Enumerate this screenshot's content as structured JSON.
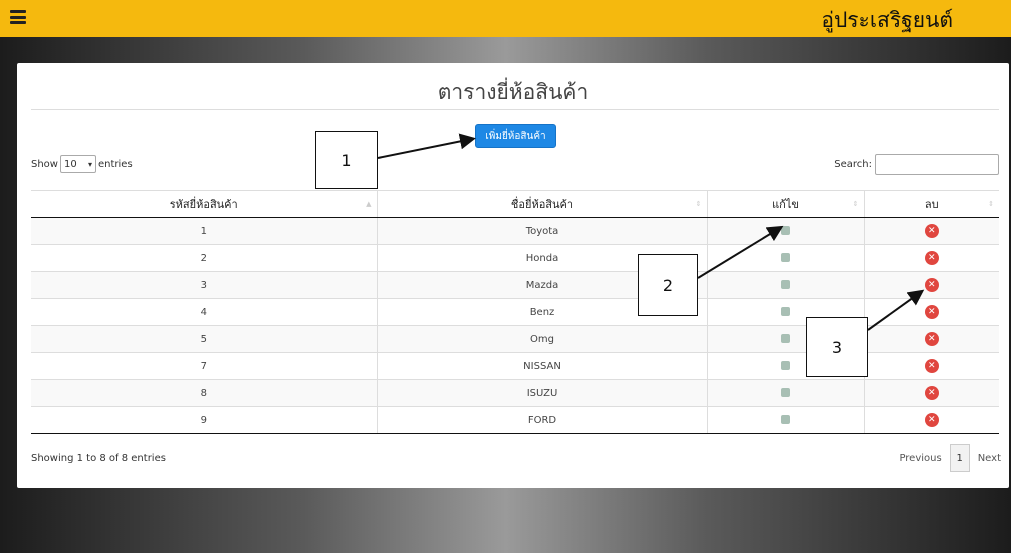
{
  "header": {
    "menu_icon": "hamburger-icon",
    "brand": "อู่ประเสริฐยนต์",
    "color": "#f5b90e"
  },
  "page": {
    "title": "ตารางยี่ห้อสินค้า",
    "add_button": "เพิ่มยี่ห้อสินค้า",
    "show_label": "Show",
    "entries_value": "10",
    "entries_label": "entries",
    "search_label": "Search:",
    "search_value": ""
  },
  "table": {
    "columns": [
      "รหัสยี่ห้อสินค้า",
      "ชื่อยี่ห้อสินค้า",
      "แก้ไข",
      "ลบ"
    ],
    "rows": [
      {
        "id": "1",
        "name": "Toyota"
      },
      {
        "id": "2",
        "name": "Honda"
      },
      {
        "id": "3",
        "name": "Mazda"
      },
      {
        "id": "4",
        "name": "Benz"
      },
      {
        "id": "5",
        "name": "Omg"
      },
      {
        "id": "7",
        "name": "NISSAN"
      },
      {
        "id": "8",
        "name": "ISUZU"
      },
      {
        "id": "9",
        "name": "FORD"
      }
    ],
    "edit_icon": "edit-icon",
    "delete_icon": "delete-icon"
  },
  "footer": {
    "info": "Showing 1 to 8 of 8 entries",
    "previous": "Previous",
    "page": "1",
    "next": "Next"
  },
  "annotations": {
    "callout_1": "1",
    "callout_2": "2",
    "callout_3": "3"
  }
}
